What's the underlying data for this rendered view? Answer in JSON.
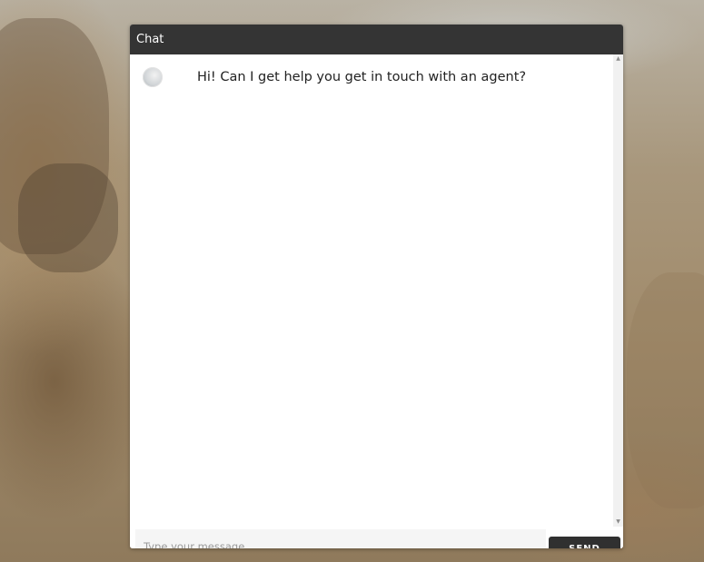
{
  "chat": {
    "title": "Chat",
    "messages": [
      {
        "text": "Hi! Can I get help you get in touch with an agent?"
      }
    ],
    "input": {
      "placeholder": "Type your message..",
      "value": ""
    },
    "send_label": "SEND"
  },
  "icons": {
    "avatar": "agent-avatar",
    "scroll_up": "scroll-up-arrow-icon",
    "scroll_down": "scroll-down-arrow-icon"
  },
  "colors": {
    "header_bg": "#343434",
    "send_bg": "#303030"
  }
}
